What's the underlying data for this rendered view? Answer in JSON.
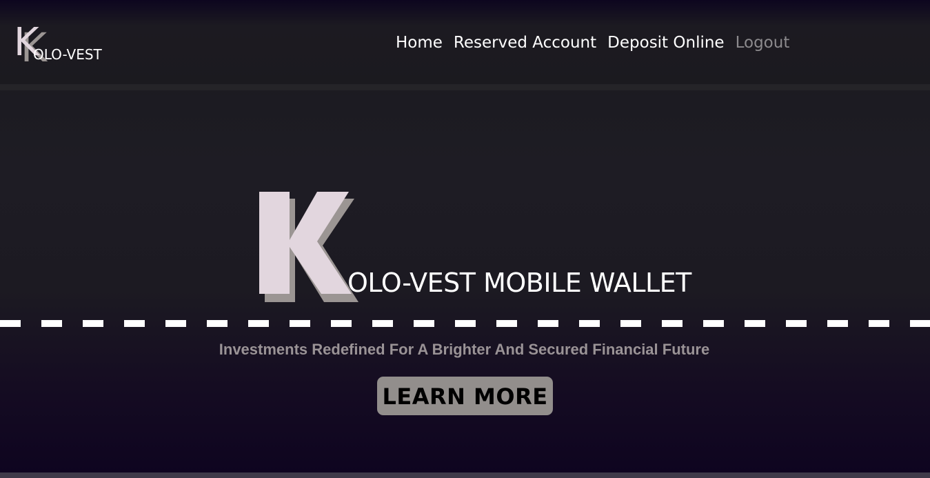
{
  "brand": {
    "initial": "K",
    "name": "OLO-VEST"
  },
  "nav": {
    "items": [
      {
        "label": "Home",
        "muted": false
      },
      {
        "label": "Reserved Account",
        "muted": false
      },
      {
        "label": "Deposit Online",
        "muted": false
      },
      {
        "label": "Logout",
        "muted": true
      }
    ]
  },
  "hero": {
    "title": "OLO-VEST MOBILE WALLET",
    "tagline": "Investments Redefined For A Brighter And Secured Financial Future",
    "cta_label": "LEARN MORE"
  },
  "colors": {
    "logo_light": "#e2d6de",
    "logo_shadow": "#9b9593",
    "button_bg": "#928e8c",
    "tagline": "#9a9396",
    "muted_link": "#8c8a8d"
  }
}
